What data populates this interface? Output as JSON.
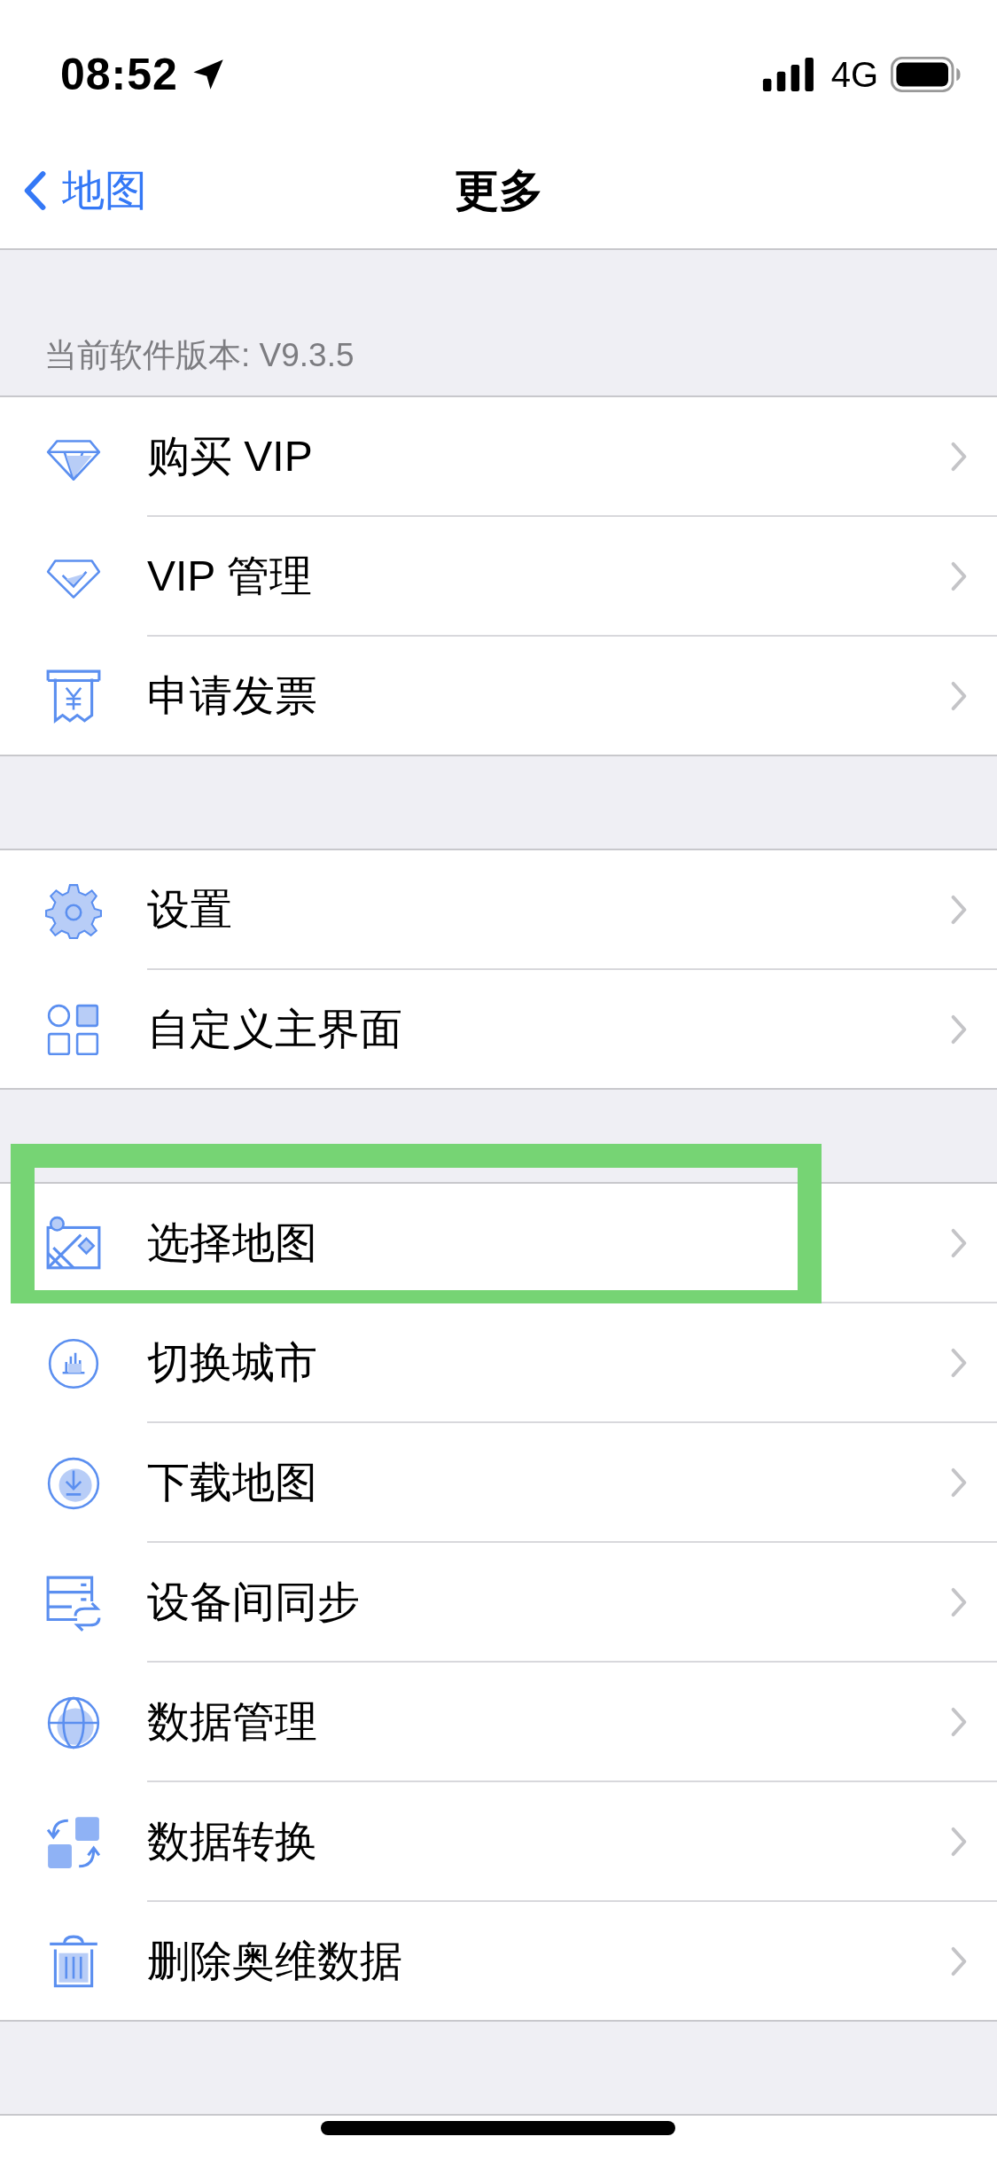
{
  "status_bar": {
    "time": "08:52",
    "network": "4G"
  },
  "nav_bar": {
    "back_label": "地图",
    "title": "更多"
  },
  "version_caption": "当前软件版本: V9.3.5",
  "groups": [
    {
      "items": [
        {
          "label": "购买 VIP",
          "highlighted": false
        },
        {
          "label": "VIP 管理",
          "highlighted": false
        },
        {
          "label": "申请发票",
          "highlighted": false
        }
      ]
    },
    {
      "items": [
        {
          "label": "设置",
          "highlighted": false
        },
        {
          "label": "自定义主界面",
          "highlighted": false
        }
      ]
    },
    {
      "items": [
        {
          "label": "选择地图",
          "highlighted": true
        },
        {
          "label": "切换城市",
          "highlighted": false
        },
        {
          "label": "下载地图",
          "highlighted": false
        },
        {
          "label": "设备间同步",
          "highlighted": false
        },
        {
          "label": "数据管理",
          "highlighted": false
        },
        {
          "label": "数据转换",
          "highlighted": false
        },
        {
          "label": "删除奥维数据",
          "highlighted": false
        }
      ]
    }
  ]
}
